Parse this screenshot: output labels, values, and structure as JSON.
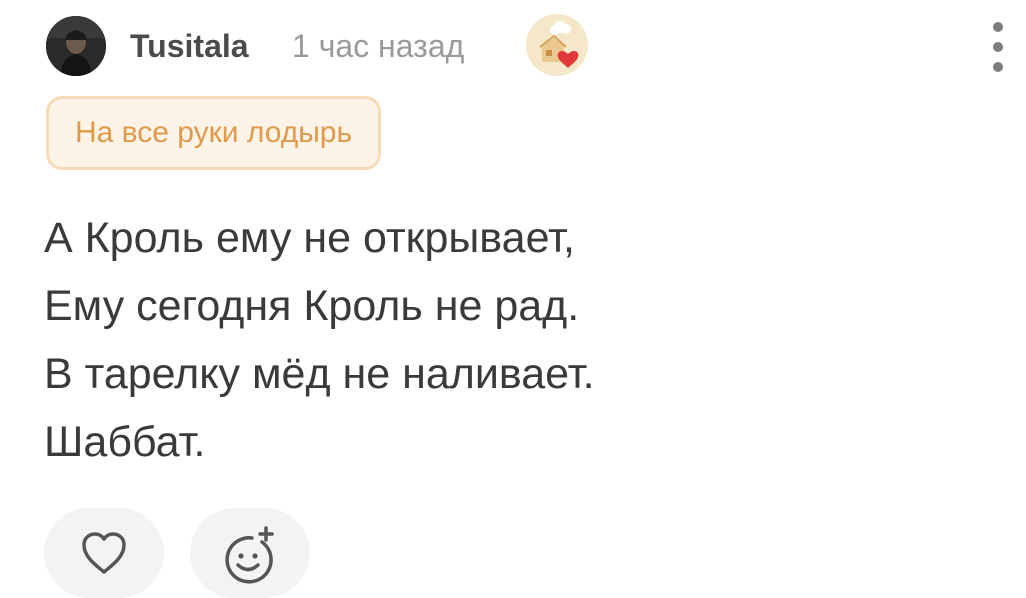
{
  "comment": {
    "author": {
      "username": "Tusitala",
      "avatar_icon": "user-avatar-photo"
    },
    "timestamp": "1 час назад",
    "user_badge_icon": "cook-house-heart-badge-icon",
    "status_tag": "На все руки лодырь",
    "text_lines": [
      "А Кроль ему не открывает,",
      "Ему сегодня Кроль не рад.",
      "В тарелку мёд не наливает.",
      "Шаббат."
    ],
    "actions": {
      "like_icon": "heart-outline-icon",
      "react_icon": "smiley-add-icon"
    }
  },
  "colors": {
    "username": "#4b4b4b",
    "timestamp": "#9a9a9a",
    "tag_text": "#e19a4b",
    "tag_bg": "#fdf3e6",
    "tag_border": "#f6dbb8",
    "body_text": "#3a3a3a",
    "action_bg": "#f3f3f3",
    "icon": "#555555"
  }
}
